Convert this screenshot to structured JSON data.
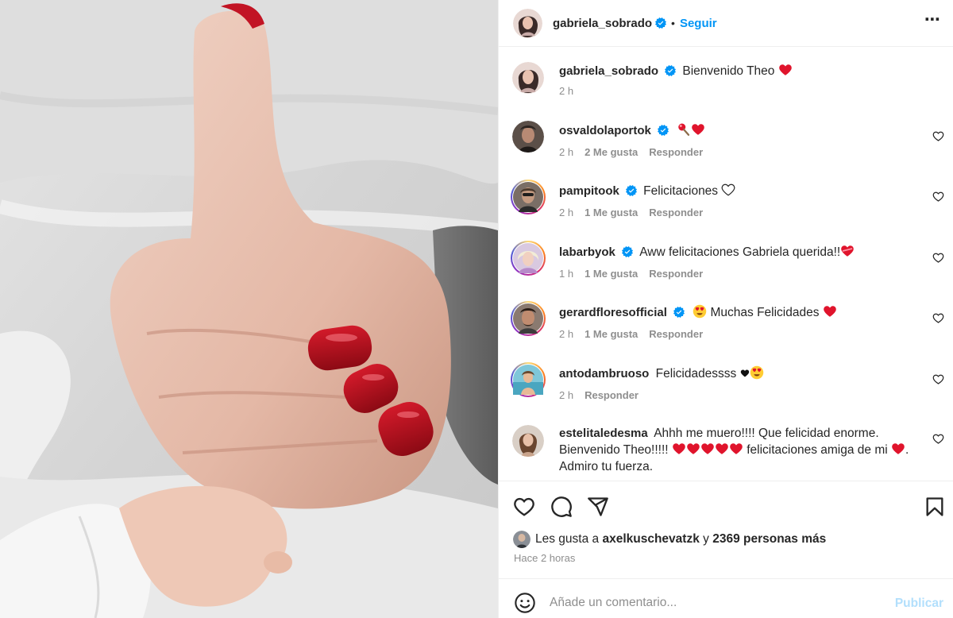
{
  "post": {
    "author": "gabriela_sobrado",
    "follow_label": "Seguir",
    "separator": "•",
    "more_label": "⋯"
  },
  "caption": {
    "username": "gabriela_sobrado",
    "text": "Bienvenido Theo",
    "time": "2 h"
  },
  "comments": [
    {
      "username": "osvaldolaportok",
      "verified": true,
      "text": "",
      "time": "2 h",
      "likes": "2 Me gusta",
      "reply": "Responder"
    },
    {
      "username": "pampitook",
      "verified": true,
      "text": "Felicitaciones",
      "time": "2 h",
      "likes": "1 Me gusta",
      "reply": "Responder"
    },
    {
      "username": "labarbyok",
      "verified": true,
      "text": "Aww felicitaciones Gabriela querida!!",
      "time": "1 h",
      "likes": "1 Me gusta",
      "reply": "Responder"
    },
    {
      "username": "gerardfloresofficial",
      "verified": true,
      "text": "Muchas Felicidades",
      "time": "2 h",
      "likes": "1 Me gusta",
      "reply": "Responder"
    },
    {
      "username": "antodambruoso",
      "verified": false,
      "text": "Felicidadessss",
      "time": "2 h",
      "likes": "",
      "reply": "Responder"
    },
    {
      "username": "estelitaledesma",
      "verified": false,
      "text_part1": "Ahhh me muero!!!! Que felicidad enorme. Bienvenido Theo!!!!!",
      "text_part2": "felicitaciones amiga de mi",
      "text_part3": ". Admiro tu fuerza."
    }
  ],
  "likes_bar": {
    "prefix": "Les gusta a",
    "user": "axelkuschevatzk",
    "connector": "y",
    "count": "2369 personas más"
  },
  "time_ago": "Hace 2 horas",
  "add_comment": {
    "placeholder": "Añade un comentario...",
    "publish_label": "Publicar"
  },
  "colors": {
    "accent": "#0095f6",
    "publish_disabled": "#b2dffc",
    "secondary_text": "#8e8e8e",
    "heart_red": "#e0142c",
    "verified_blue": "#0095f6"
  },
  "icons": [
    "verified-icon",
    "more-icon",
    "heart-icon",
    "comment-icon",
    "share-icon",
    "bookmark-icon",
    "emoji-smile-icon"
  ]
}
